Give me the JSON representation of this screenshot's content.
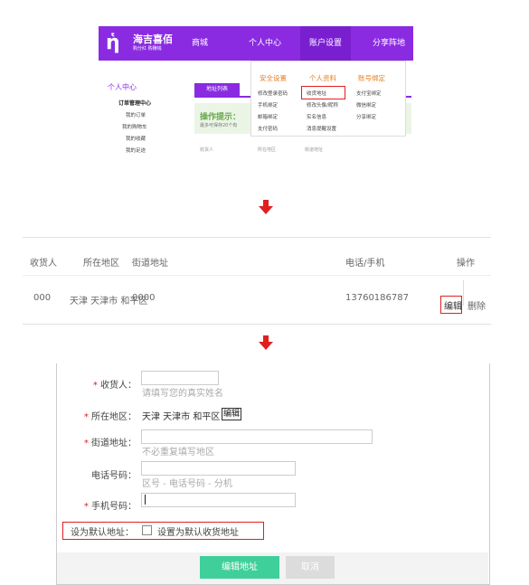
{
  "panel1": {
    "logo_mark": "ἡ",
    "logo_text": "海吉喜佰",
    "logo_sub": "购分红 购赚钱",
    "nav": [
      "商城",
      "个人中心",
      "账户设置",
      "分享阵地"
    ],
    "sidebar_title": "个人中心",
    "sidebar_items": [
      "订单管理中心",
      "我的订单",
      "我的购物车",
      "我的收藏",
      "我的足迹"
    ],
    "tab_label": "地址列表",
    "tip_title": "操作提示：",
    "tip_sub": "最多可保存20个有",
    "table_headers": [
      "收货人",
      "所在地区",
      "街道地址"
    ],
    "dropdown": {
      "headers": [
        "安全设置",
        "个人资料",
        "账号绑定"
      ],
      "col1": [
        "修改登录密码",
        "手机绑定",
        "邮箱绑定",
        "支付密码"
      ],
      "col2": [
        "收货地址",
        "修改头像/昵称",
        "实名信息",
        "消息提醒设置"
      ],
      "col3": [
        "支付宝绑定",
        "微信绑定",
        "分享绑定"
      ]
    }
  },
  "panel2": {
    "headers": [
      "收货人",
      "所在地区",
      "街道地址",
      "电话/手机",
      "操作"
    ],
    "row": {
      "name": "000",
      "region": "天津 天津市 和平区",
      "street": "0000",
      "phone": "13760186787",
      "edit": "编辑",
      "delete": "删除"
    }
  },
  "panel3": {
    "required_mark": "*",
    "receiver_label": "收货人：",
    "receiver_hint": "请填写您的真实姓名",
    "region_label": "所在地区：",
    "region_value": "天津 天津市 和平区",
    "region_edit": "编辑",
    "street_label": "街道地址：",
    "street_hint": "不必重复填写地区",
    "tel_label": "电话号码：",
    "tel_hint": "区号 - 电话号码 - 分机",
    "mobile_label": "手机号码：",
    "default_label": "设为默认地址：",
    "default_checkbox_text": "设置为默认收货地址",
    "submit_label": "编辑地址",
    "cancel_label": "取消"
  },
  "colors": {
    "brand_purple": "#8a2be2",
    "highlight_red": "#e02020",
    "submit_green": "#3fcf9b"
  }
}
